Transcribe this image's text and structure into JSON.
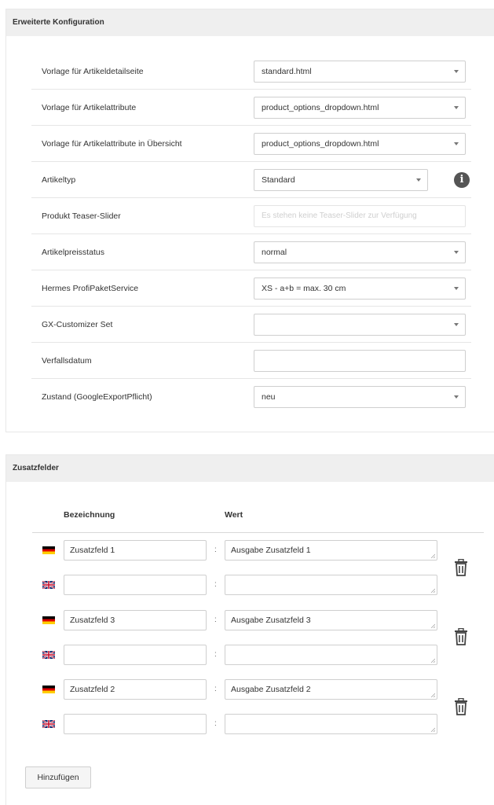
{
  "config": {
    "title": "Erweiterte Konfiguration",
    "rows": [
      {
        "label": "Vorlage für Artikeldetailseite",
        "value": "standard.html"
      },
      {
        "label": "Vorlage für Artikelattribute",
        "value": "product_options_dropdown.html"
      },
      {
        "label": "Vorlage für Artikelattribute in Übersicht",
        "value": "product_options_dropdown.html"
      },
      {
        "label": "Artikeltyp",
        "value": "Standard",
        "info_icon": "info-icon"
      },
      {
        "label": "Produkt Teaser-Slider",
        "placeholder": "Es stehen keine Teaser-Slider zur Verfügung"
      },
      {
        "label": "Artikelpreisstatus",
        "value": "normal"
      },
      {
        "label": "Hermes ProfiPaketService",
        "value": "XS - a+b = max. 30 cm"
      },
      {
        "label": "GX-Customizer Set",
        "value": ""
      },
      {
        "label": "Verfallsdatum",
        "value": ""
      },
      {
        "label": "Zustand (GoogleExportPflicht)",
        "value": "neu"
      }
    ]
  },
  "extra_fields": {
    "title": "Zusatzfelder",
    "col_name": "Bezeichnung",
    "col_value": "Wert",
    "separator": ":",
    "groups": [
      {
        "de": {
          "name": "Zusatzfeld 1",
          "value": "Ausgabe Zusatzfeld 1"
        },
        "en": {
          "name": "",
          "value": ""
        }
      },
      {
        "de": {
          "name": "Zusatzfeld 3",
          "value": "Ausgabe Zusatzfeld 3"
        },
        "en": {
          "name": "",
          "value": ""
        }
      },
      {
        "de": {
          "name": "Zusatzfeld 2",
          "value": "Ausgabe Zusatzfeld 2"
        },
        "en": {
          "name": "",
          "value": ""
        }
      }
    ],
    "add_label": "Hinzufügen"
  },
  "icons": {
    "delete": "trash-icon",
    "info": "info-icon",
    "language_de": "flag-de-icon",
    "language_en": "flag-uk-icon"
  },
  "colors": {
    "header_bg": "#efefef",
    "border": "#cfcfcf",
    "info": "#555555"
  }
}
